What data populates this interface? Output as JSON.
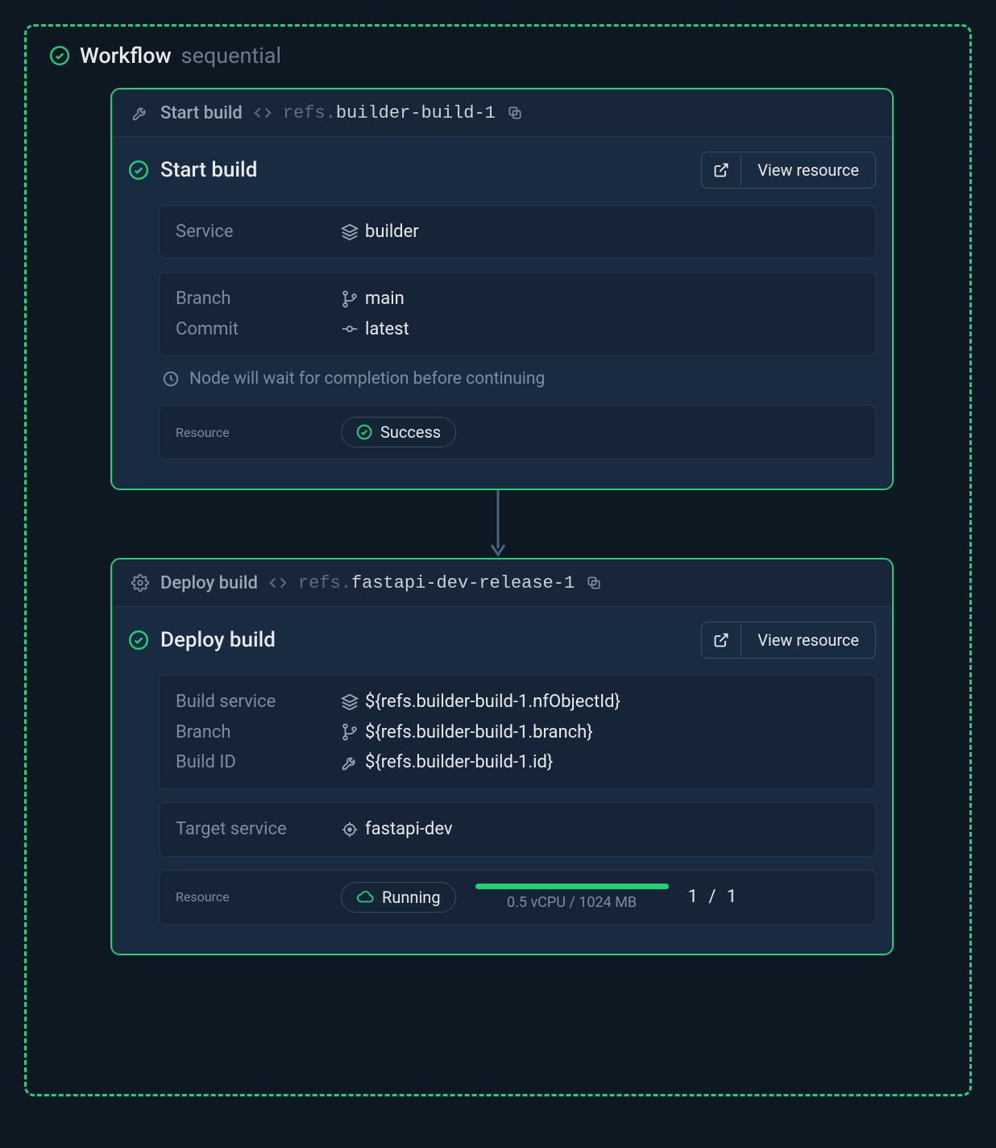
{
  "workflow": {
    "title": "Workflow",
    "mode": "sequential"
  },
  "nodes": [
    {
      "header_title": "Start build",
      "ref_prefix": "refs.",
      "ref_name": "builder-build-1",
      "body_title": "Start build",
      "view_resource_label": "View resource",
      "rows1": [
        {
          "label": "Service",
          "icon": "layers",
          "value": "builder"
        }
      ],
      "rows2": [
        {
          "label": "Branch",
          "icon": "git-branch",
          "value": "main"
        },
        {
          "label": "Commit",
          "icon": "git-commit",
          "value": "latest"
        }
      ],
      "wait_note": "Node will wait for completion before continuing",
      "resource_label": "Resource",
      "status_text": "Success",
      "status_kind": "success"
    },
    {
      "header_title": "Deploy build",
      "ref_prefix": "refs.",
      "ref_name": "fastapi-dev-release-1",
      "body_title": "Deploy build",
      "view_resource_label": "View resource",
      "rows1": [
        {
          "label": "Build service",
          "icon": "layers",
          "value": "${refs.builder-build-1.nfObjectId}"
        },
        {
          "label": "Branch",
          "icon": "git-branch",
          "value": "${refs.builder-build-1.branch}"
        },
        {
          "label": "Build ID",
          "icon": "wrench",
          "value": "${refs.builder-build-1.id}"
        }
      ],
      "rows2": [
        {
          "label": "Target service",
          "icon": "crosshair",
          "value": "fastapi-dev"
        }
      ],
      "resource_label": "Resource",
      "status_text": "Running",
      "status_kind": "running",
      "progress_caption": "0.5 vCPU / 1024 MB",
      "fraction": "1  /  1"
    }
  ]
}
